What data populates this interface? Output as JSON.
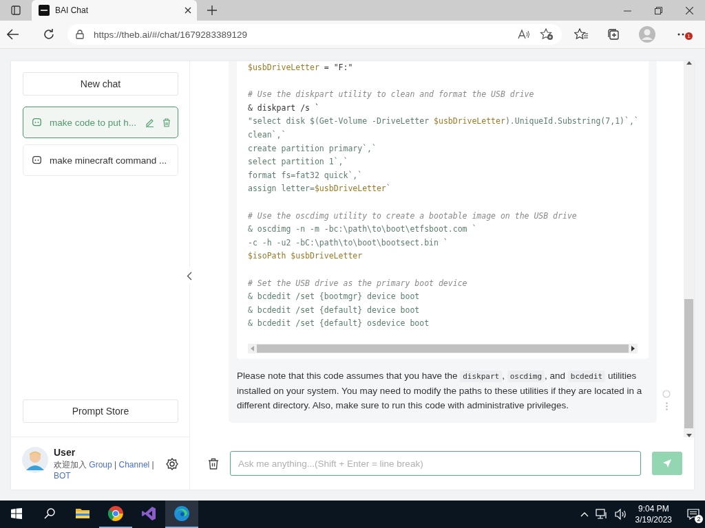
{
  "browser": {
    "tab_title": "BAI Chat",
    "url": "https://theb.ai/#/chat/1679283389129",
    "menu_badge": "1"
  },
  "sidebar": {
    "new_chat": "New chat",
    "chats": [
      {
        "title": "make code to put h...",
        "selected": true
      },
      {
        "title": "make minecraft command ...",
        "selected": false
      }
    ],
    "prompt_store": "Prompt Store",
    "user": {
      "name": "User",
      "welcome": [
        {
          "kind": "text",
          "text": "欢迎加入"
        },
        {
          "kind": "link",
          "text": "Group"
        },
        {
          "kind": "text",
          "text": "|"
        },
        {
          "kind": "link",
          "text": "Channel"
        },
        {
          "kind": "text",
          "text": "|"
        },
        {
          "kind": "link",
          "text": "BOT"
        }
      ]
    }
  },
  "chat": {
    "code_blocks": [
      [
        [
          {
            "kind": "var",
            "text": "$usbDriveLetter"
          },
          {
            "kind": "plain",
            "text": " = \"F:\""
          }
        ]
      ],
      [
        [
          {
            "kind": "comment",
            "text": "# Use the diskpart utility to clean and format the USB drive"
          }
        ],
        [
          {
            "kind": "plain",
            "text": "& diskpart /s `"
          }
        ],
        [
          {
            "kind": "string",
            "text": "\"select disk $(Get-Volume -DriveLetter "
          },
          {
            "kind": "var",
            "text": "$usbDriveLetter"
          },
          {
            "kind": "string",
            "text": ").UniqueId.Substring(7,1)`,`"
          }
        ],
        [
          {
            "kind": "string",
            "text": "clean`,`"
          }
        ],
        [
          {
            "kind": "string",
            "text": "create partition primary`,`"
          }
        ],
        [
          {
            "kind": "string",
            "text": "select partition 1`,`"
          }
        ],
        [
          {
            "kind": "string",
            "text": "format fs=fat32 quick`,`"
          }
        ],
        [
          {
            "kind": "string",
            "text": "assign letter="
          },
          {
            "kind": "var",
            "text": "$usbDriveLetter"
          },
          {
            "kind": "string",
            "text": "`"
          }
        ]
      ],
      [
        [
          {
            "kind": "comment",
            "text": "# Use the oscdimg utility to create a bootable image on the USB drive"
          }
        ],
        [
          {
            "kind": "string",
            "text": "& oscdimg -n -m -bc:\\path\\to\\boot\\etfsboot.com `"
          }
        ],
        [
          {
            "kind": "string",
            "text": "-c -h -u2 -bC:\\path\\to\\boot\\bootsect.bin `"
          }
        ],
        [
          {
            "kind": "var",
            "text": "$isoPath $usbDriveLetter"
          }
        ]
      ],
      [
        [
          {
            "kind": "comment",
            "text": "# Set the USB drive as the primary boot device"
          }
        ],
        [
          {
            "kind": "string",
            "text": "& bcdedit /set {bootmgr} device boot"
          }
        ],
        [
          {
            "kind": "string",
            "text": "& bcdedit /set {default} device boot"
          }
        ],
        [
          {
            "kind": "string",
            "text": "& bcdedit /set {default} osdevice boot"
          }
        ]
      ]
    ],
    "note": [
      {
        "kind": "text",
        "text": "Please note that this code assumes that you have the "
      },
      {
        "kind": "code",
        "text": "diskpart"
      },
      {
        "kind": "text",
        "text": ", "
      },
      {
        "kind": "code",
        "text": "oscdimg"
      },
      {
        "kind": "text",
        "text": ", and "
      },
      {
        "kind": "code",
        "text": "bcdedit"
      },
      {
        "kind": "text",
        "text": " utilities installed on your system. You may need to modify the paths to these utilities if they are located in a different directory. Also, make sure to run this code with administrative privileges."
      }
    ],
    "input": {
      "placeholder": "Ask me anything...(Shift + Enter = line break)"
    }
  },
  "taskbar": {
    "apps": [
      {
        "kind": "explorer",
        "running": false,
        "selected": false
      },
      {
        "kind": "chrome",
        "running": true,
        "selected": false
      },
      {
        "kind": "studio",
        "running": false,
        "selected": false
      },
      {
        "kind": "edge",
        "running": true,
        "selected": true
      }
    ],
    "time": "9:04 PM",
    "date": "3/19/2023",
    "notifications": "2"
  }
}
